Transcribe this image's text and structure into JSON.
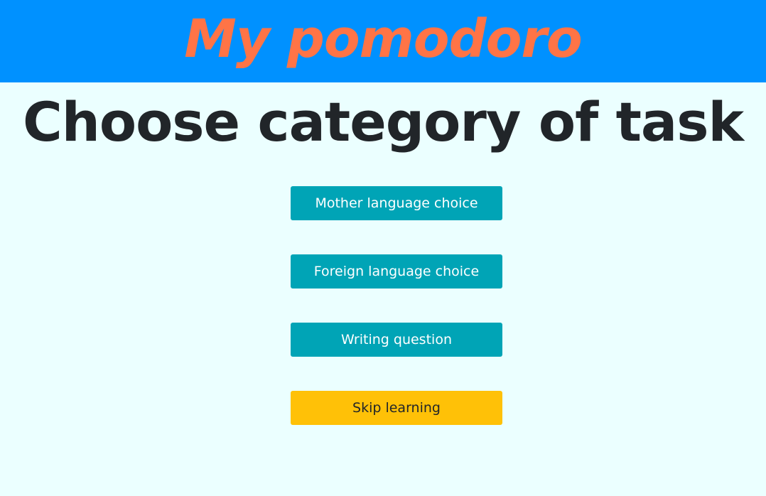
{
  "header": {
    "app_title": "My pomodoro"
  },
  "main": {
    "heading": "Choose category of task",
    "buttons": [
      {
        "label": "Mother language choice",
        "style": "info"
      },
      {
        "label": "Foreign language choice",
        "style": "info"
      },
      {
        "label": "Writing question",
        "style": "info"
      },
      {
        "label": "Skip learning",
        "style": "warning"
      }
    ]
  },
  "colors": {
    "header_bg": "#0091ff",
    "title_color": "#ff7446",
    "page_bg": "#ebffff",
    "info_button": "#00a4b6",
    "warning_button": "#ffc107",
    "heading_text": "#212529"
  }
}
